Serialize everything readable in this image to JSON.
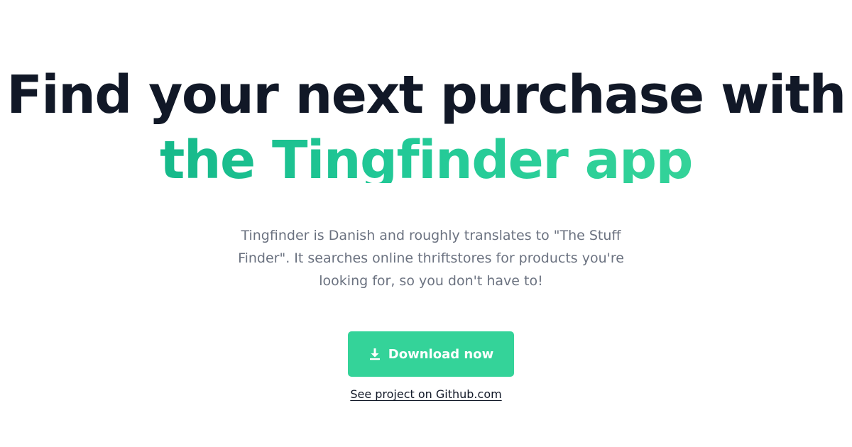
{
  "hero": {
    "headline_line_1": "Find your next purchase with",
    "headline_line_2": "the Tingfinder app",
    "description": "Tingfinder is Danish and roughly translates to \"The Stuff Finder\". It searches online thriftstores for products you're looking for, so you don't have to!",
    "download_button_label": "Download now",
    "download_icon": "download-icon",
    "github_link_label": "See project on Github.com"
  },
  "colors": {
    "heading": "#111827",
    "accent_start": "#16b98a",
    "accent_end": "#34d399",
    "button": "#34d399",
    "body_text": "#6b7280"
  }
}
